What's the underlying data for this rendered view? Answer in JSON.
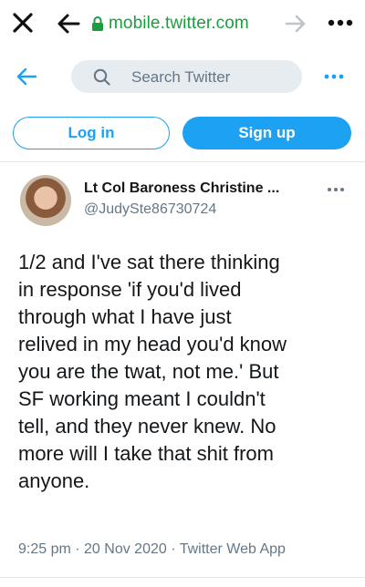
{
  "browser": {
    "url": "mobile.twitter.com",
    "icons": {
      "close": "close-icon",
      "back": "arrow-left-icon",
      "lock": "lock-icon",
      "forward": "arrow-right-icon",
      "menu": "more-dots-icon"
    },
    "colors": {
      "url": "#1b9e3e"
    }
  },
  "header": {
    "search_placeholder": "Search Twitter",
    "icons": {
      "back": "arrow-left-icon",
      "search": "search-icon",
      "more": "more-dots-icon"
    }
  },
  "auth": {
    "login_label": "Log in",
    "signup_label": "Sign up"
  },
  "tweet": {
    "display_name": "Lt Col Baroness Christine ...",
    "handle": "@JudySte86730724",
    "text": "1/2 and I've sat there thinking\nin response 'if you'd lived\nthrough what I have just\nrelived in my head you'd know\nyou are the twat, not me.' But\nSF working meant I couldn't\ntell, and they never knew. No\nmore will I take that shit from\nanyone.",
    "time": "9:25 pm",
    "date": "20 Nov 2020",
    "source": "Twitter Web App",
    "meta_separator": " · "
  },
  "colors": {
    "accent": "#1da1f2",
    "secondary_text": "#657786",
    "primary_text": "#14171a"
  }
}
